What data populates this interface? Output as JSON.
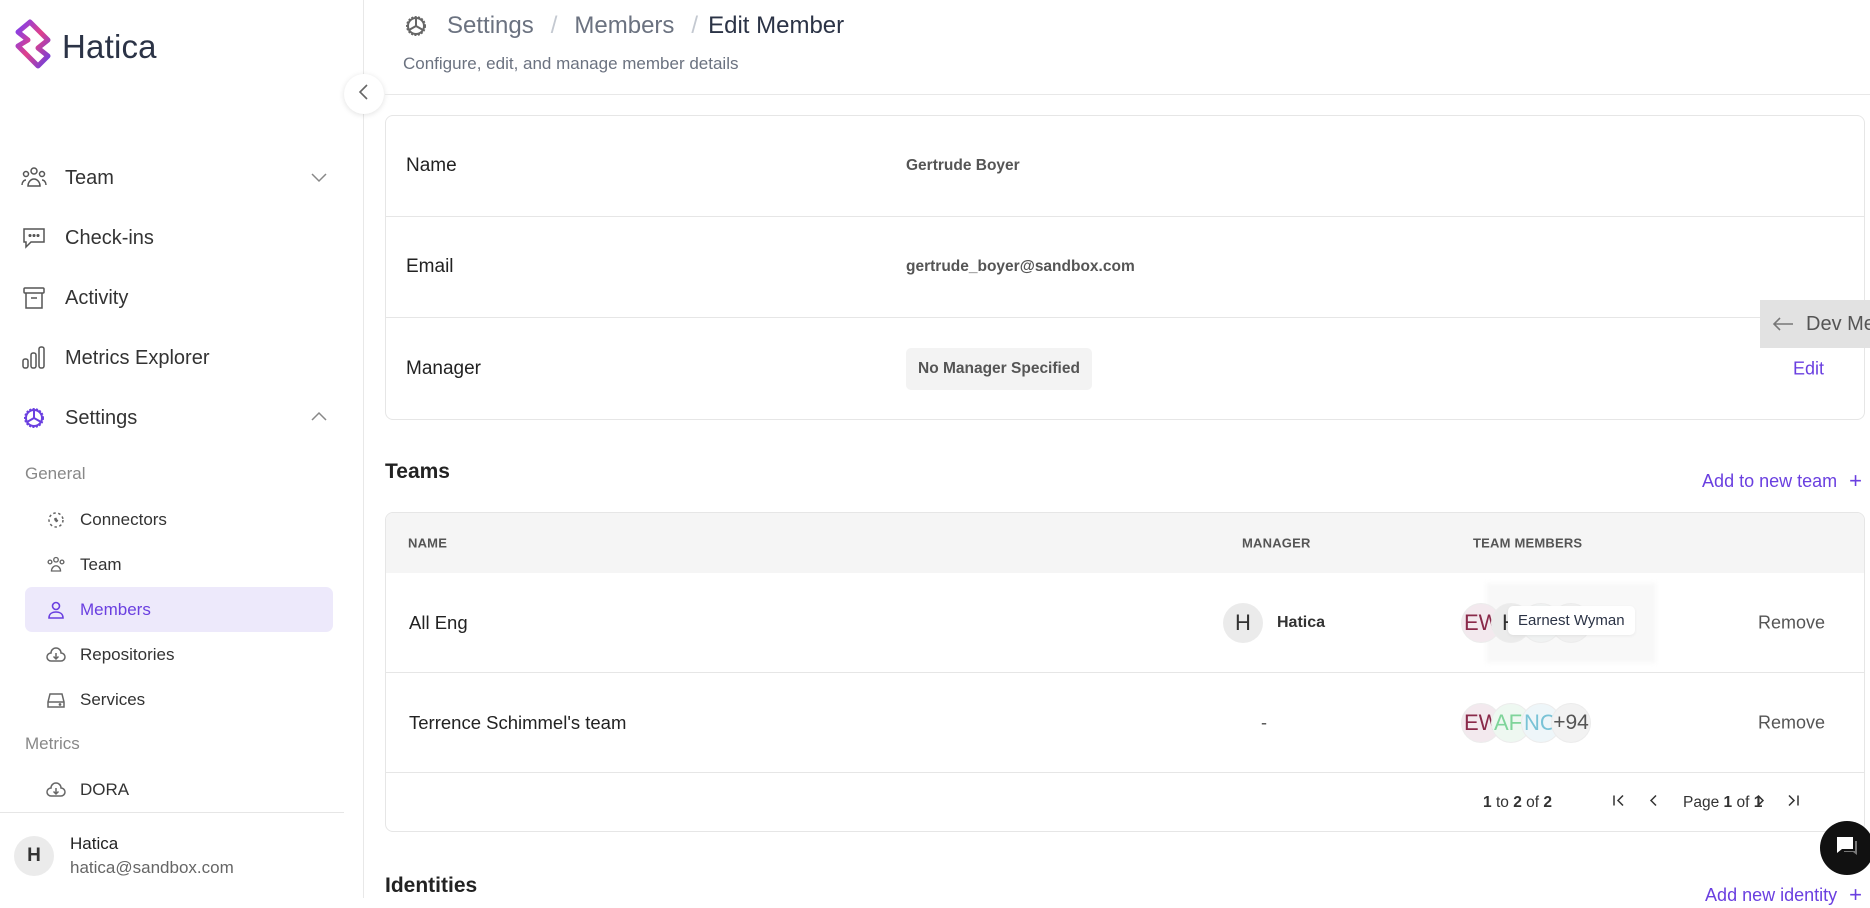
{
  "app": {
    "name": "Hatica"
  },
  "sidebar": {
    "nav": [
      {
        "label": "Team",
        "icon": "users-icon",
        "expanded": false
      },
      {
        "label": "Check-ins",
        "icon": "chat-bubble-icon"
      },
      {
        "label": "Activity",
        "icon": "archive-box-icon"
      },
      {
        "label": "Metrics Explorer",
        "icon": "bar-chart-icon"
      },
      {
        "label": "Settings",
        "icon": "gear-icon",
        "expanded": true
      }
    ],
    "groups": [
      {
        "label": "General",
        "items": [
          {
            "label": "Connectors",
            "icon": "connectors-icon"
          },
          {
            "label": "Team",
            "icon": "users-icon"
          },
          {
            "label": "Members",
            "icon": "user-icon",
            "active": true
          },
          {
            "label": "Repositories",
            "icon": "cloud-download-icon"
          },
          {
            "label": "Services",
            "icon": "server-icon"
          }
        ]
      },
      {
        "label": "Metrics",
        "items": [
          {
            "label": "DORA",
            "icon": "cloud-download-icon"
          }
        ]
      }
    ],
    "user": {
      "initial": "H",
      "name": "Hatica",
      "email": "hatica@sandbox.com"
    }
  },
  "header": {
    "breadcrumb": [
      "Settings",
      "Members",
      "Edit Member"
    ],
    "separator": "/",
    "subtitle": "Configure, edit, and manage member details"
  },
  "member": {
    "fields": [
      {
        "label": "Name",
        "value": "Gertrude Boyer"
      },
      {
        "label": "Email",
        "value": "gertrude_boyer@sandbox.com"
      },
      {
        "label": "Manager",
        "value": "No Manager Specified",
        "action": "Edit"
      }
    ]
  },
  "dev_tab": {
    "label": "Dev Me"
  },
  "teams": {
    "title": "Teams",
    "add_label": "Add to new team",
    "columns": [
      "NAME",
      "MANAGER",
      "TEAM MEMBERS"
    ],
    "rows": [
      {
        "name": "All Eng",
        "manager_initial": "H",
        "manager": "Hatica",
        "members": [
          {
            "initials": "EW",
            "color": "#8a2a4a",
            "bg": "#f3e9ee"
          },
          {
            "initials": "H",
            "color": "#333333",
            "bg": "#ebebeb"
          },
          {
            "initials": "",
            "color": "#333333",
            "bg": "#f0f2f2"
          },
          {
            "initials": "",
            "color": "#333333",
            "bg": "#f0f0f0"
          }
        ],
        "tooltip": "Earnest Wyman",
        "action": "Remove"
      },
      {
        "name": "Terrence Schimmel's team",
        "manager": "-",
        "members": [
          {
            "initials": "EW",
            "color": "#8a2a4a",
            "bg": "#f3e9ee"
          },
          {
            "initials": "AF",
            "color": "#7fd49a",
            "bg": "#eef8f1"
          },
          {
            "initials": "NC",
            "color": "#79c3d6",
            "bg": "#eef6f9"
          }
        ],
        "more": "+94",
        "action": "Remove"
      }
    ],
    "pagination": {
      "from": "1",
      "to": "2",
      "total": "2",
      "page": "1",
      "pages": "1",
      "to_word": "to",
      "of_word": "of",
      "page_word": "Page"
    }
  },
  "identities": {
    "title": "Identities",
    "add_label": "Add new identity"
  },
  "colors": {
    "accent": "#6a3fe0",
    "active_bg": "#ede9fb"
  }
}
